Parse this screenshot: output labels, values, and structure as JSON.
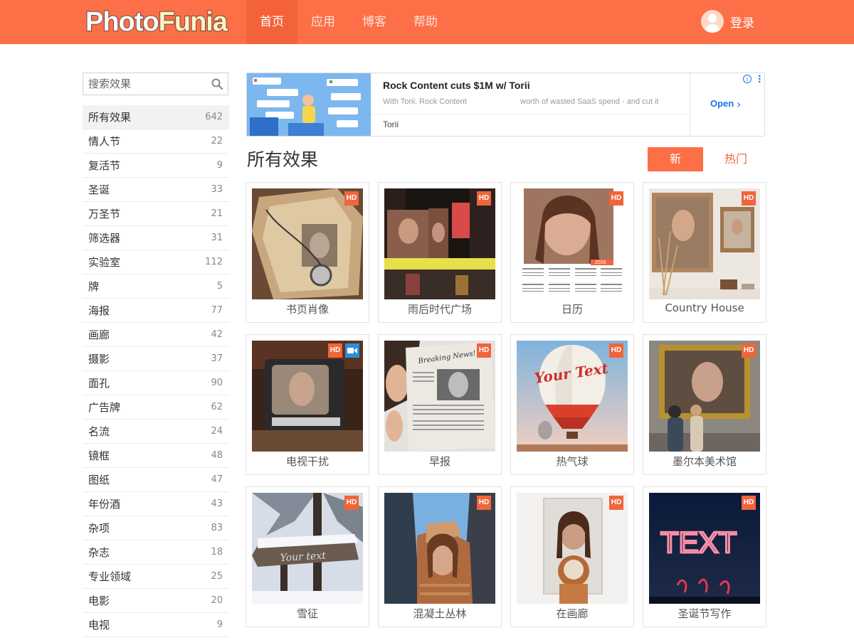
{
  "header": {
    "logo_part1": "Photo",
    "logo_part2": "Funia",
    "nav": [
      {
        "label": "首页",
        "active": true
      },
      {
        "label": "应用",
        "active": false
      },
      {
        "label": "博客",
        "active": false
      },
      {
        "label": "帮助",
        "active": false
      }
    ],
    "login_label": "登录"
  },
  "sidebar": {
    "search_placeholder": "搜索效果",
    "categories": [
      {
        "name": "所有效果",
        "count": "642",
        "active": true
      },
      {
        "name": "情人节",
        "count": "22"
      },
      {
        "name": "复活节",
        "count": "9"
      },
      {
        "name": "圣诞",
        "count": "33"
      },
      {
        "name": "万圣节",
        "count": "21"
      },
      {
        "name": "筛选器",
        "count": "31"
      },
      {
        "name": "实验室",
        "count": "112"
      },
      {
        "name": "牌",
        "count": "5"
      },
      {
        "name": "海报",
        "count": "77"
      },
      {
        "name": "画廊",
        "count": "42"
      },
      {
        "name": "摄影",
        "count": "37"
      },
      {
        "name": "面孔",
        "count": "90"
      },
      {
        "name": "广告牌",
        "count": "62"
      },
      {
        "name": "名流",
        "count": "24"
      },
      {
        "name": "镜框",
        "count": "48"
      },
      {
        "name": "图纸",
        "count": "47"
      },
      {
        "name": "年份酒",
        "count": "43"
      },
      {
        "name": "杂项",
        "count": "83"
      },
      {
        "name": "杂志",
        "count": "18"
      },
      {
        "name": "专业领域",
        "count": "25"
      },
      {
        "name": "电影",
        "count": "20"
      },
      {
        "name": "电视",
        "count": "9"
      }
    ]
  },
  "ad": {
    "headline": "Rock Content cuts $1M w/ Torii",
    "desc_left": "With Torii, Rock Content",
    "desc_right": "worth of wasted SaaS spend - and cut it",
    "brand": "Torii",
    "cta": "Open",
    "info": "i"
  },
  "main": {
    "title": "所有效果",
    "sort_new": "新",
    "sort_hot": "热门",
    "hd_badge": "HD",
    "calendar_year": "2026",
    "effects": [
      {
        "title": "书页肖像",
        "hd": true,
        "video": false,
        "icon": "book-page-portrait"
      },
      {
        "title": "雨后时代广场",
        "hd": true,
        "video": false,
        "icon": "times-square"
      },
      {
        "title": "日历",
        "hd": true,
        "video": false,
        "icon": "calendar"
      },
      {
        "title": "Country House",
        "hd": true,
        "video": false,
        "icon": "country-house"
      },
      {
        "title": "电视干扰",
        "hd": true,
        "video": true,
        "icon": "tv-interference"
      },
      {
        "title": "早报",
        "hd": true,
        "video": false,
        "icon": "morning-newspaper"
      },
      {
        "title": "热气球",
        "hd": true,
        "video": false,
        "icon": "hot-air-balloon"
      },
      {
        "title": "墨尔本美术馆",
        "hd": true,
        "video": false,
        "icon": "melbourne-gallery"
      },
      {
        "title": "雪征",
        "hd": true,
        "video": false,
        "icon": "snow-sign"
      },
      {
        "title": "混凝土丛林",
        "hd": true,
        "video": false,
        "icon": "concrete-jungle"
      },
      {
        "title": "在画廊",
        "hd": true,
        "video": false,
        "icon": "in-gallery"
      },
      {
        "title": "圣诞节写作",
        "hd": true,
        "video": false,
        "icon": "christmas-writing"
      }
    ],
    "balloon_text": "Your Text",
    "snow_text": "Your text",
    "neon_text": "TEXT",
    "newspaper_text": "Breaking News!"
  },
  "colors": {
    "brand": "#fc6f47",
    "nav_active": "#f4623a",
    "hd_badge": "#f0653b",
    "video_badge": "#2b8ed8",
    "ad_link": "#1a73e8"
  }
}
